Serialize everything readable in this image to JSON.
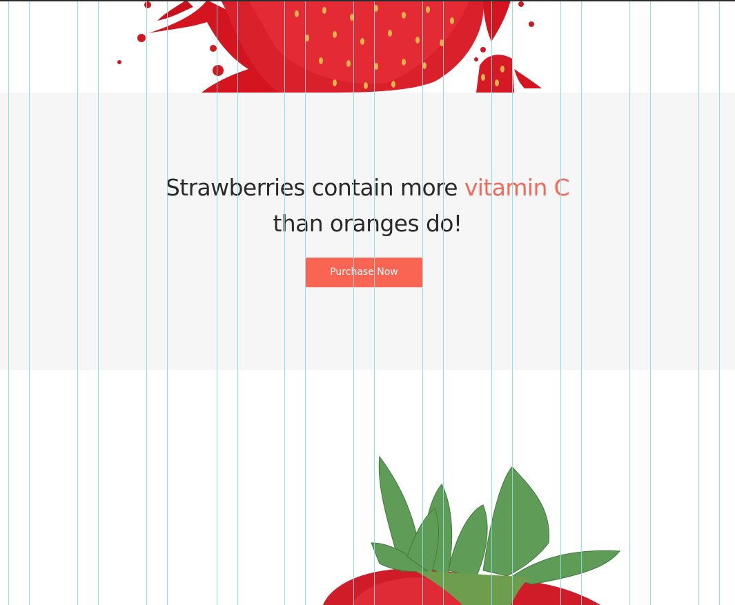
{
  "cta": {
    "headline_part1": "Strawberries contain more ",
    "headline_accent": "vitamin C",
    "headline_part2": "than oranges do!",
    "button_label": "Purchase Now"
  },
  "colors": {
    "accent": "#f26a5b",
    "button": "#fa6553",
    "section_background": "#f6f6f6",
    "guide_lines": "#7fe0e6"
  },
  "images": {
    "hero": "strawberry-splash-image",
    "bottom": "strawberry-with-leaves-image"
  }
}
